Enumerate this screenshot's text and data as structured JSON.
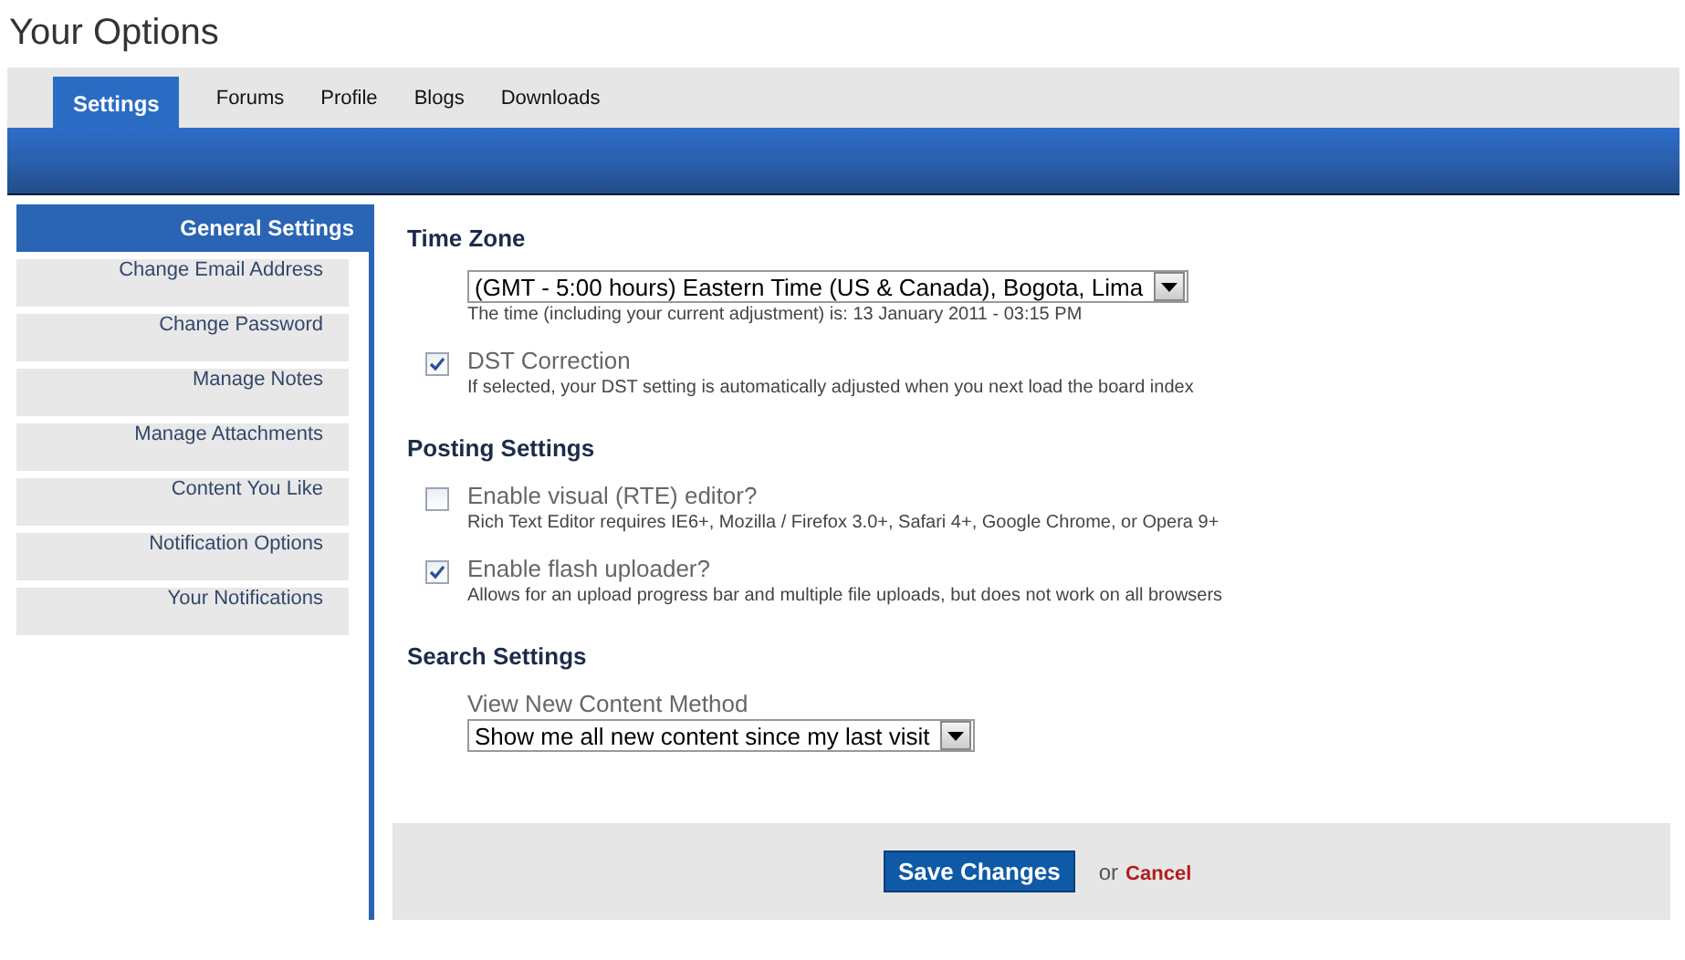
{
  "page_title": "Your Options",
  "tabs": [
    {
      "label": "Settings",
      "selected": true
    },
    {
      "label": "Forums",
      "selected": false
    },
    {
      "label": "Profile",
      "selected": false
    },
    {
      "label": "Blogs",
      "selected": false
    },
    {
      "label": "Downloads",
      "selected": false
    }
  ],
  "sidebar": {
    "header": "General Settings",
    "items": [
      "Change Email Address",
      "Change Password",
      "Manage Notes",
      "Manage Attachments",
      "Content You Like",
      "Notification Options",
      "Your Notifications"
    ]
  },
  "sections": [
    {
      "heading": "Time Zone",
      "fields": [
        {
          "kind": "select",
          "value": "(GMT - 5:00 hours) Eastern Time (US & Canada), Bogota, Lima",
          "hint": "The time (including your current adjustment) is: 13 January 2011 - 03:15 PM"
        },
        {
          "kind": "checkbox",
          "label": "DST Correction",
          "checked": true,
          "hint": "If selected, your DST setting is automatically adjusted when you next load the board index"
        }
      ]
    },
    {
      "heading": "Posting Settings",
      "fields": [
        {
          "kind": "checkbox",
          "label": "Enable visual (RTE) editor?",
          "checked": false,
          "hint": "Rich Text Editor requires IE6+, Mozilla / Firefox 3.0+, Safari 4+, Google Chrome, or Opera 9+"
        },
        {
          "kind": "checkbox",
          "label": "Enable flash uploader?",
          "checked": true,
          "hint": "Allows for an upload progress bar and multiple file uploads, but does not work on all browsers"
        }
      ]
    },
    {
      "heading": "Search Settings",
      "fields": [
        {
          "kind": "select",
          "label": "View New Content Method",
          "value": "Show me all new content since my last visit"
        }
      ]
    }
  ],
  "footer": {
    "save": "Save Changes",
    "or": "or",
    "cancel": "Cancel"
  }
}
